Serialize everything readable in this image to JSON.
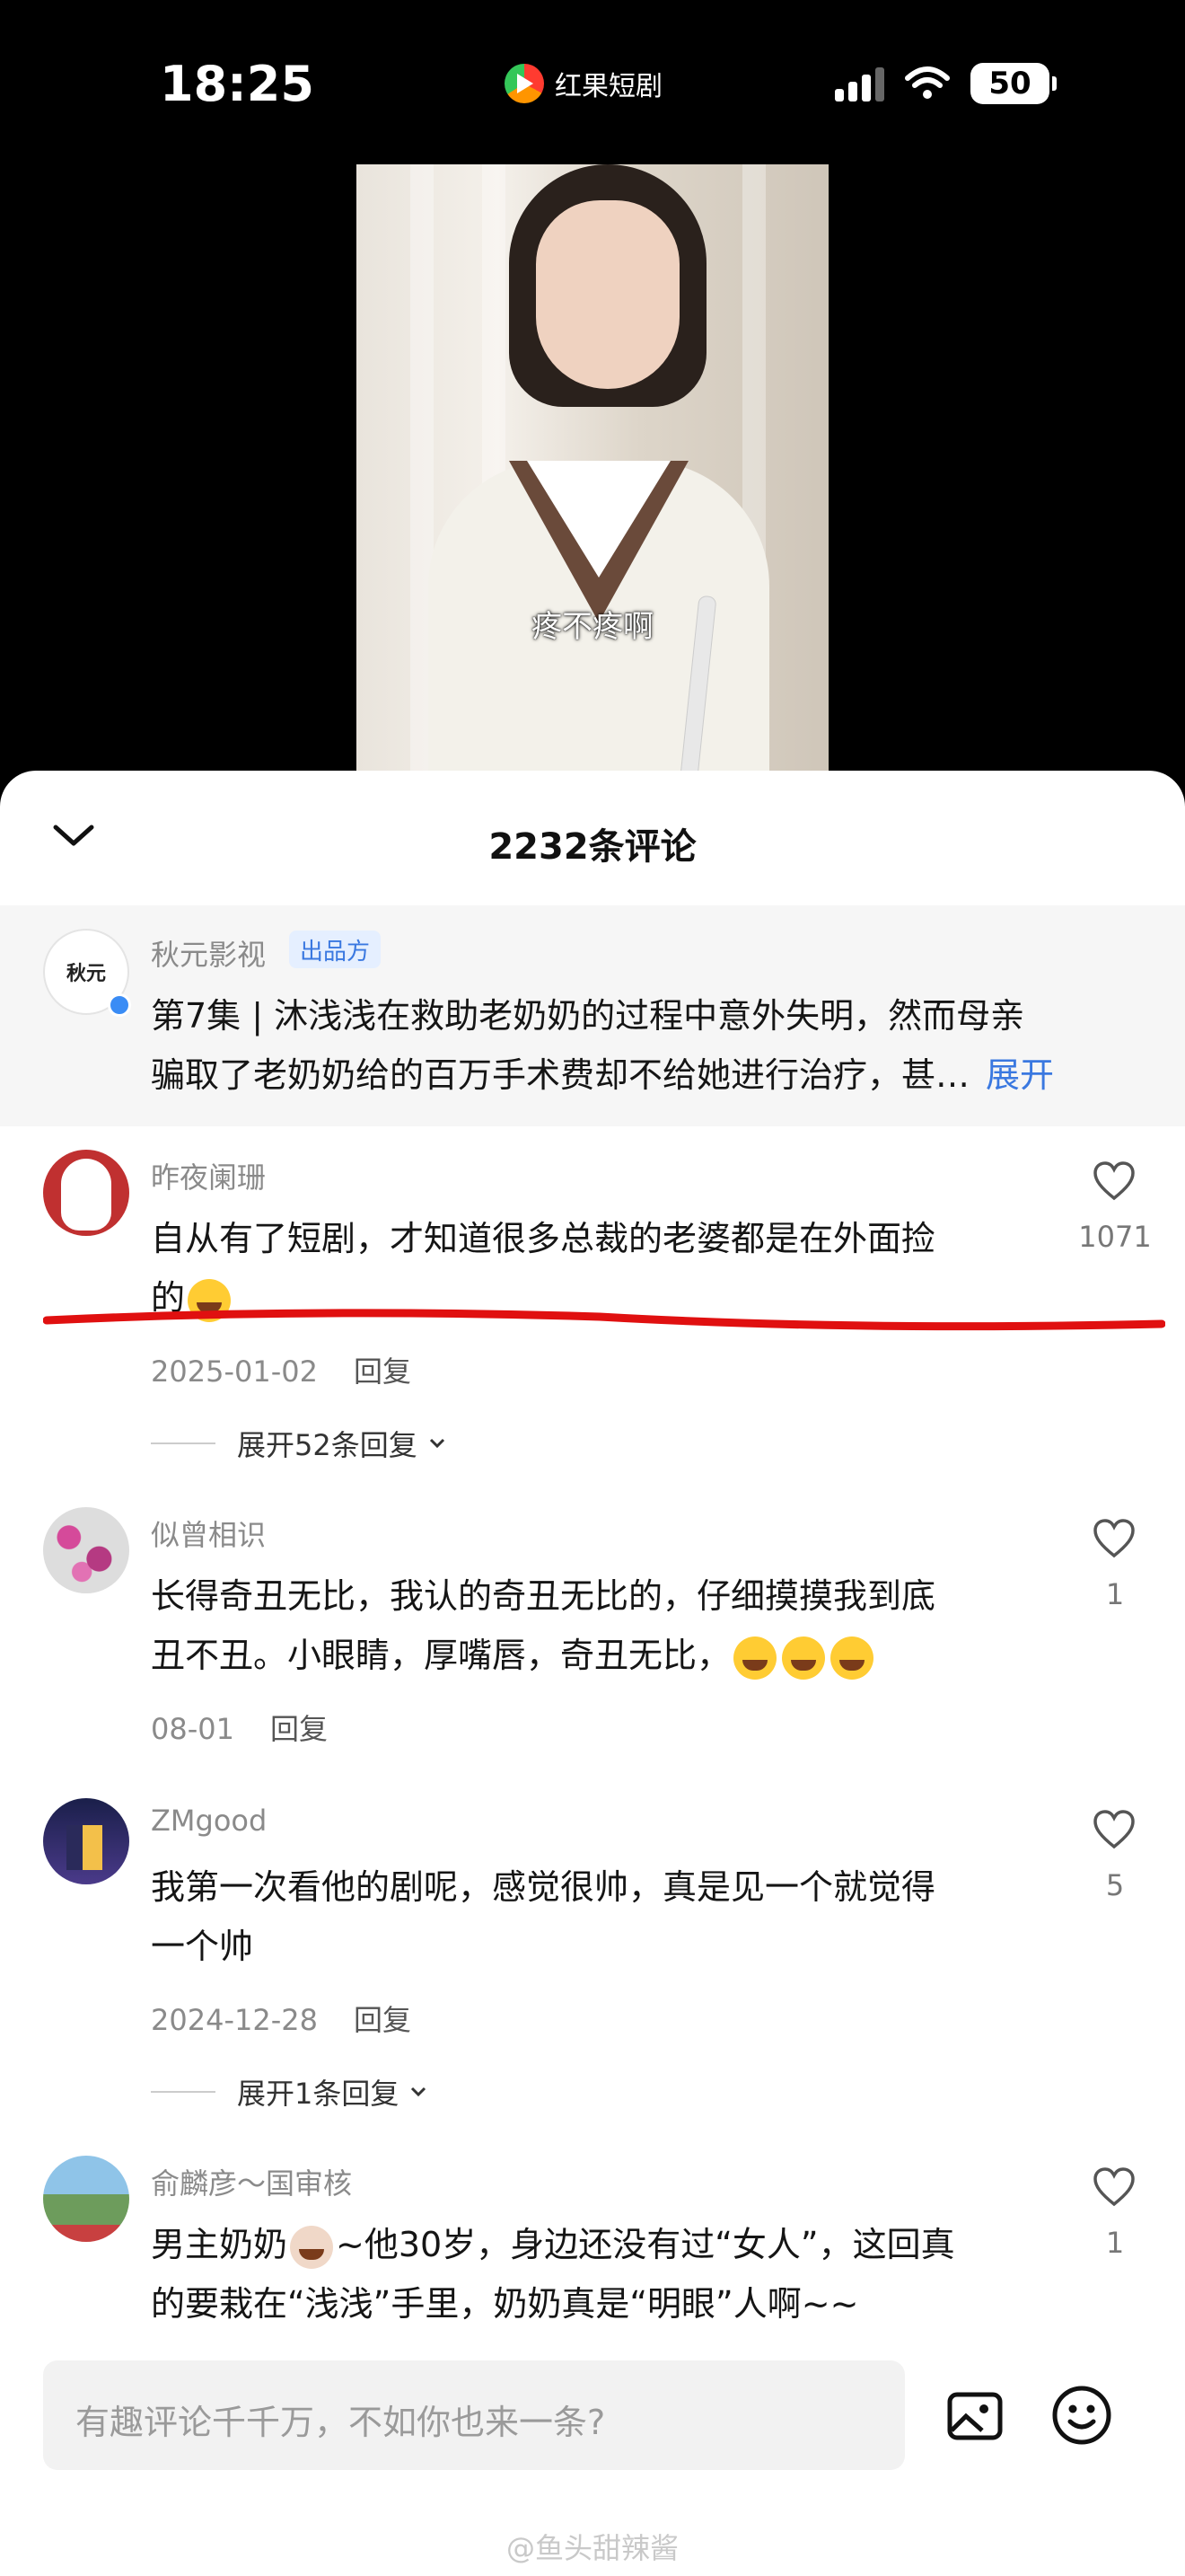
{
  "status": {
    "time": "18:25",
    "app_name": "红果短剧",
    "battery": "50"
  },
  "video": {
    "subtitle": "疼不疼啊"
  },
  "sheet": {
    "title": "2232条评论"
  },
  "pinned": {
    "username": "秋元影视",
    "badge": "出品方",
    "avatar_text": "秋元",
    "text_line1": "第7集 | 沐浅浅在救助老奶奶的过程中意外失明，然而母亲",
    "text_line2": "骗取了老奶奶给的百万手术费却不给她进行治疗，甚…",
    "expand": "展开"
  },
  "comments": [
    {
      "username": "昨夜阑珊",
      "line1": "自从有了短剧，才知道很多总裁的老婆都是在外面捡",
      "line2": "的",
      "date": "2025-01-02",
      "reply": "回复",
      "more": "展开52条回复",
      "likes": "1071"
    },
    {
      "username": "似曾相识",
      "line1": "长得奇丑无比，我认的奇丑无比的，仔细摸摸我到底",
      "line2": "丑不丑。小眼睛，厚嘴唇，奇丑无比，",
      "date": "08-01",
      "reply": "回复",
      "likes": "1"
    },
    {
      "username": "ZMgood",
      "line1": "我第一次看他的剧呢，感觉很帅，真是见一个就觉得",
      "line2": "一个帅",
      "date": "2024-12-28",
      "reply": "回复",
      "more": "展开1条回复",
      "likes": "5"
    },
    {
      "username": "俞麟彦～国审核",
      "line1a": "男主奶奶",
      "line1b": "~他30岁，身边还没有过“女人”，这回真",
      "line2": "的要栽在“浅浅”手里，奶奶真是“明眼”人啊~~",
      "likes": "1"
    }
  ],
  "input": {
    "placeholder": "有趣评论千千万，不如你也来一条?"
  },
  "watermark": "@鱼头甜辣酱",
  "colors": {
    "accent": "#3a78e0",
    "annotation": "#e01010"
  }
}
